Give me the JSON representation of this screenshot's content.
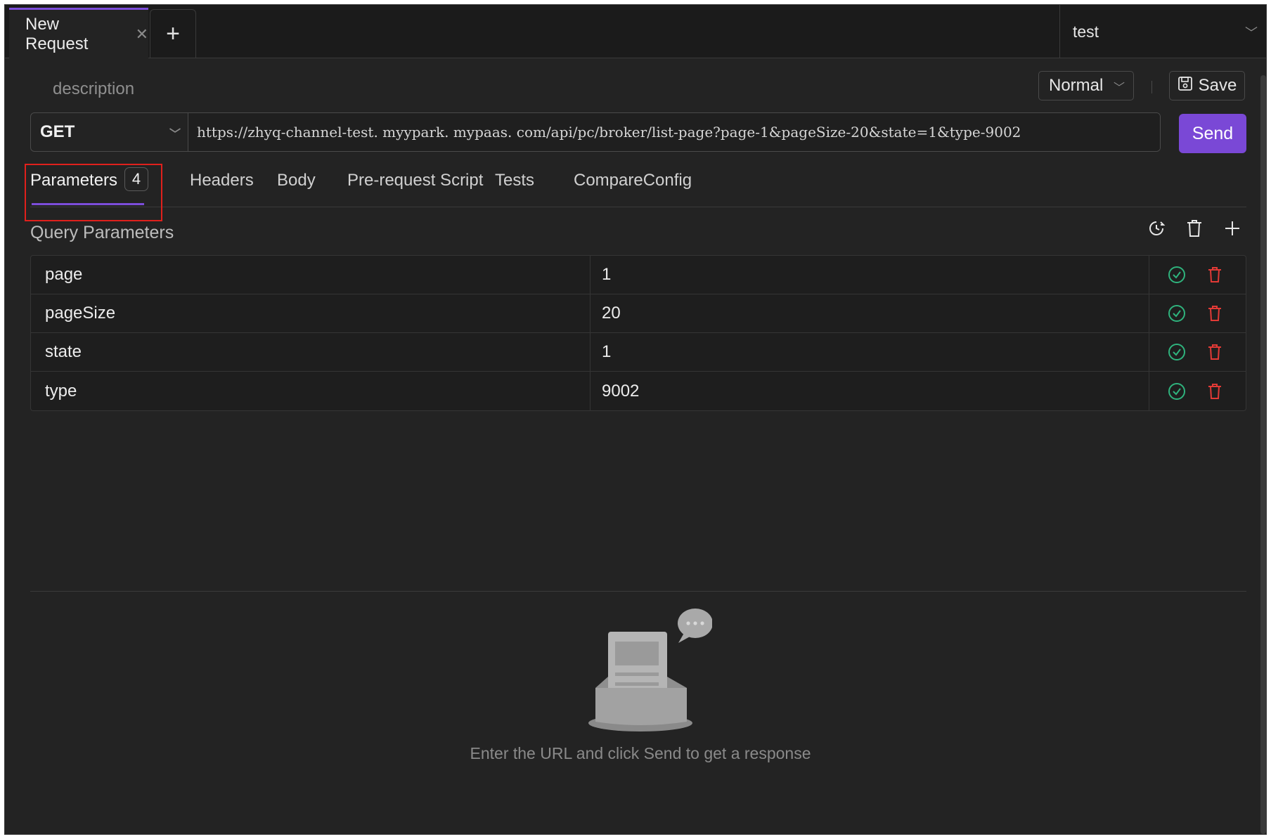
{
  "tabs": {
    "active_tab_label": "New Request",
    "close_glyph": "✕",
    "add_tab_glyph": "+"
  },
  "environment": {
    "selected": "test"
  },
  "request": {
    "description_placeholder": "description",
    "mode": "Normal",
    "save_label": "Save",
    "method": "GET",
    "url": "https://zhyq-channel-test. myypark. mypaas. com/api/pc/broker/list-page?page-1&pageSize-20&state=1&type-9002",
    "send_label": "Send"
  },
  "subtabs": [
    {
      "label": "Parameters",
      "badge": "4"
    },
    {
      "label": "Headers"
    },
    {
      "label": "Body"
    },
    {
      "label": "Pre-request Script"
    },
    {
      "label": "Tests"
    },
    {
      "label": "CompareConfig"
    }
  ],
  "query_params": {
    "title": "Query Parameters",
    "rows": [
      {
        "key": "page",
        "value": "1"
      },
      {
        "key": "pageSize",
        "value": "20"
      },
      {
        "key": "state",
        "value": "1"
      },
      {
        "key": "type",
        "value": "9002"
      }
    ]
  },
  "response": {
    "empty_message": "Enter the URL and click Send to get a response"
  },
  "colors": {
    "accent": "#7a48d6",
    "enabled_green": "#2fb37d",
    "delete_red": "#e23a36",
    "highlight_red": "#e0201c"
  },
  "icons": {
    "history": "history-icon",
    "trash": "trash-icon",
    "plus": "plus-icon",
    "check": "check-circle-icon",
    "save": "save-icon"
  }
}
